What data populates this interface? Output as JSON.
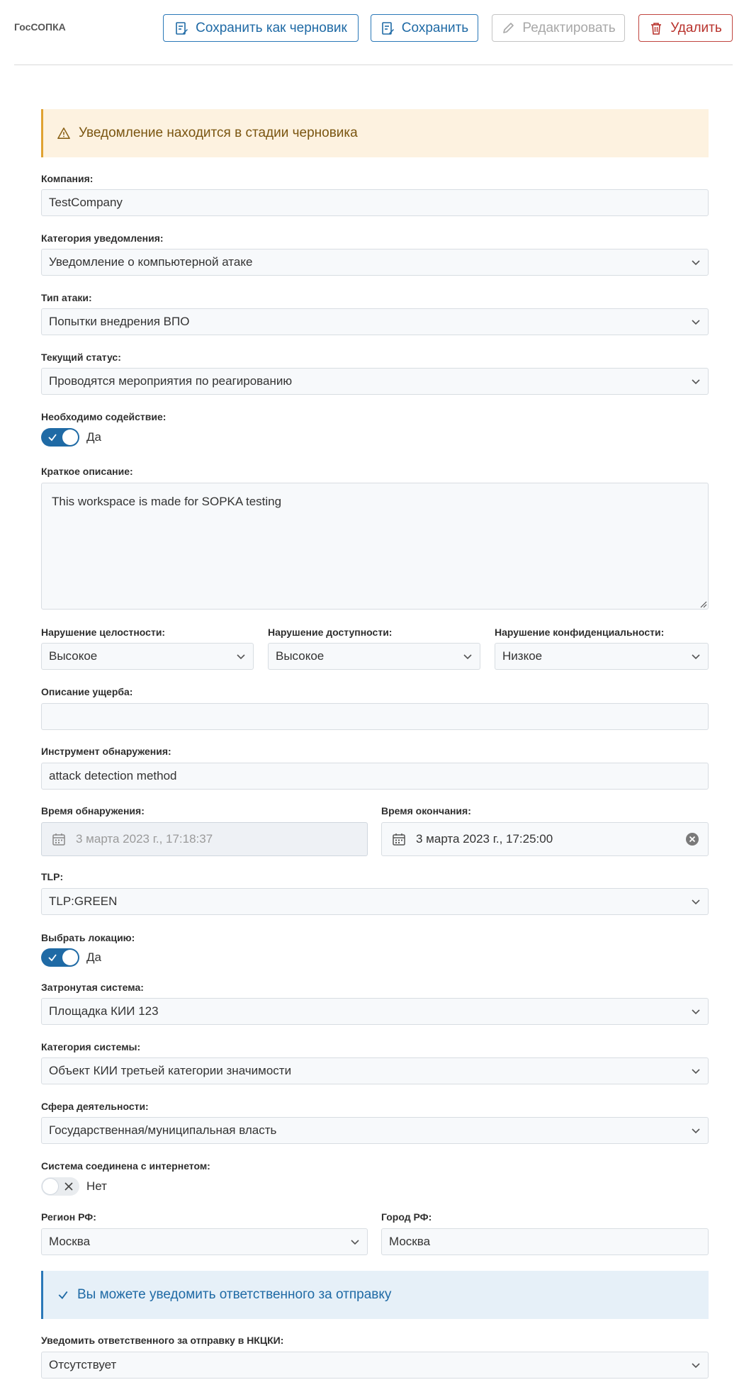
{
  "app": {
    "brand": "ГосСОПКА"
  },
  "toolbar": {
    "save_draft": "Сохранить как черновик",
    "save": "Сохранить",
    "edit": "Редактировать",
    "delete": "Удалить"
  },
  "draft_alert": "Уведомление находится в стадии черновика",
  "form": {
    "company": {
      "label": "Компания:",
      "value": "TestCompany"
    },
    "notification_category": {
      "label": "Категория уведомления:",
      "value": "Уведомление о компьютерной атаке"
    },
    "attack_type": {
      "label": "Тип атаки:",
      "value": "Попытки внедрения ВПО"
    },
    "current_status": {
      "label": "Текущий статус:",
      "value": "Проводятся мероприятия по реагированию"
    },
    "assistance_needed": {
      "label": "Необходимо содействие:",
      "state": "on",
      "text": "Да"
    },
    "short_description": {
      "label": "Краткое описание:",
      "value": "This workspace is made for SOPKA testing"
    },
    "integrity": {
      "label": "Нарушение целостности:",
      "value": "Высокое"
    },
    "availability": {
      "label": "Нарушение доступности:",
      "value": "Высокое"
    },
    "confidentiality": {
      "label": "Нарушение конфиденциальности:",
      "value": "Низкое"
    },
    "damage_description": {
      "label": "Описание ущерба:",
      "value": ""
    },
    "detection_tool": {
      "label": "Инструмент обнаружения:",
      "value": "attack detection method"
    },
    "detection_time": {
      "label": "Время обнаружения:",
      "value": "3 марта 2023 г., 17:18:37"
    },
    "end_time": {
      "label": "Время окончания:",
      "value": "3 марта 2023 г., 17:25:00"
    },
    "tlp": {
      "label": "TLP:",
      "value": "TLP:GREEN"
    },
    "choose_location": {
      "label": "Выбрать локацию:",
      "state": "on",
      "text": "Да"
    },
    "affected_system": {
      "label": "Затронутая система:",
      "value": "Площадка КИИ 123"
    },
    "system_category": {
      "label": "Категория системы:",
      "value": "Объект КИИ третьей категории значимости"
    },
    "activity_sphere": {
      "label": "Сфера деятельности:",
      "value": "Государственная/муниципальная власть"
    },
    "internet_connected": {
      "label": "Система соединена с интернетом:",
      "state": "off",
      "text": "Нет"
    },
    "region": {
      "label": "Регион РФ:",
      "value": "Москва"
    },
    "city": {
      "label": "Город РФ:",
      "value": "Москва"
    },
    "notify_responsible": {
      "label": "Уведомить ответственного за отправку в НКЦКИ:",
      "value": "Отсутствует"
    }
  },
  "info_alert": "Вы можете уведомить ответственного за отправку",
  "colors": {
    "accent": "#1f6aa5",
    "warning_bg": "#fdf2e0",
    "info_bg": "#e6f0f8",
    "danger": "#b8322c"
  },
  "icons": [
    "draft-icon",
    "save-icon",
    "pencil-icon",
    "trash-icon",
    "warning-icon",
    "chevron-down-icon",
    "calendar-icon",
    "clear-icon",
    "check-icon",
    "close-icon"
  ]
}
